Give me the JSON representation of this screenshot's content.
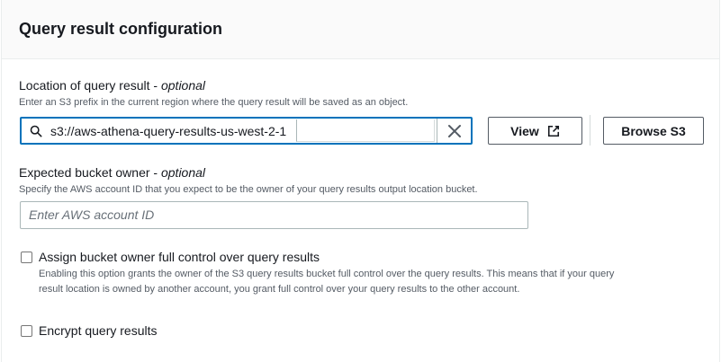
{
  "panel": {
    "title": "Query result configuration"
  },
  "location": {
    "label": "Location of query result - ",
    "label_optional": "optional",
    "description": "Enter an S3 prefix in the current region where the query result will be saved as an object.",
    "value": "s3://aws-athena-query-results-us-west-2-1",
    "view_label": "View",
    "browse_label": "Browse S3"
  },
  "owner": {
    "label": "Expected bucket owner - ",
    "label_optional": "optional",
    "description": "Specify the AWS account ID that you expect to be the owner of your query results output location bucket.",
    "placeholder": "Enter AWS account ID",
    "value": ""
  },
  "full_control": {
    "label": "Assign bucket owner full control over query results",
    "checked": false,
    "description_line1": "Enabling this option grants the owner of the S3 query results bucket full control over the query results. This means that if your query",
    "description_line2": "result location is owned by another account, you grant full control over your query results to the other account."
  },
  "encrypt": {
    "label": "Encrypt query results",
    "checked": false
  },
  "colors": {
    "focus": "#0073bb",
    "text": "#16191f",
    "secondary_text": "#545b64",
    "border": "#aab7b8"
  },
  "icons": {
    "search": "search-icon",
    "clear": "close-icon",
    "external": "external-link-icon"
  }
}
